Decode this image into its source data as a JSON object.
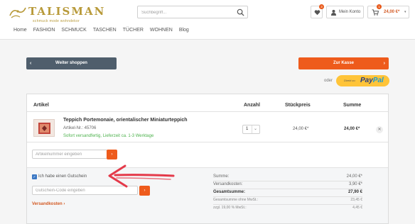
{
  "header": {
    "logo_text": "TALISMAN",
    "logo_tagline": "schmuck mode wohndekor",
    "search_placeholder": "Suchbegriff...",
    "wishlist_count": "3",
    "account_label": "Mein Konto",
    "cart_count": "1",
    "cart_total": "24,00 €*"
  },
  "nav": [
    "Home",
    "FASHION",
    "SCHMUCK",
    "TASCHEN",
    "TÜCHER",
    "WOHNEN",
    "Blog"
  ],
  "actions": {
    "continue_label": "Weiter shoppen",
    "checkout_label": "Zur Kasse",
    "or_label": "oder",
    "paypal_prefix": "Direkt zu",
    "paypal_pay": "Pay",
    "paypal_pal": "Pal"
  },
  "table": {
    "headers": {
      "article": "Artikel",
      "qty": "Anzahl",
      "unit": "Stückpreis",
      "sum": "Summe"
    }
  },
  "item": {
    "name": "Teppich Portemonaie, orientalischer Miniaturteppich",
    "number": "Artikel-Nr.: 45706",
    "shipping": "Sofort versandfertig, Lieferzeit ca. 1-3 Werktage",
    "qty": "1",
    "unit_price": "24,00 €*",
    "total": "24,00 €*"
  },
  "article_input_placeholder": "Artikelnummer eingeben",
  "voucher": {
    "checkbox_label": "Ich habe einen Gutschein",
    "input_placeholder": "Gutschein-Code eingeben"
  },
  "shipping_link": "Versandkosten",
  "summary": {
    "sum_label": "Summe:",
    "sum_value": "24,00 €*",
    "shipping_label": "Versandkosten:",
    "shipping_value": "3,90 €*",
    "total_label": "Gesamtsumme:",
    "total_value": "27,90 €",
    "net_label": "Gesamtsumme ohne MwSt.:",
    "net_value": "23,45 €",
    "tax_label": "zzgl. 19,00 % MwSt.:",
    "tax_value": "4,45 €"
  },
  "colors": {
    "accent": "#ee5b1c",
    "dark_button": "#4f5e6c",
    "success": "#4db24d",
    "paypal": "#ffc439"
  }
}
